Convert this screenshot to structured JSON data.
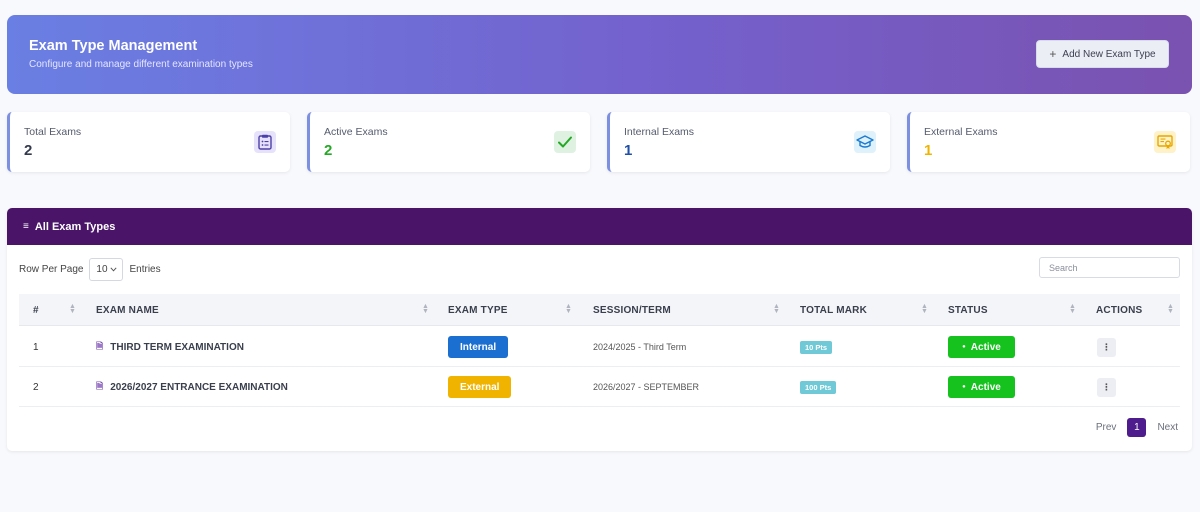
{
  "header": {
    "title": "Exam Type Management",
    "subtitle": "Configure and manage different examination types",
    "add_button_label": "Add New Exam Type"
  },
  "stats": [
    {
      "label": "Total Exams",
      "value": "2",
      "color": "#333a4d",
      "icon": "clipboard-icon",
      "icon_bg": "#e7e2fb",
      "icon_color": "#4b3fa8"
    },
    {
      "label": "Active Exams",
      "value": "2",
      "color": "#23a923",
      "icon": "check-icon",
      "icon_bg": "#dff2e2",
      "icon_color": "#23a923"
    },
    {
      "label": "Internal Exams",
      "value": "1",
      "color": "#1f4fa8",
      "icon": "graduation-cap-icon",
      "icon_bg": "#dff1fb",
      "icon_color": "#1a7bd1"
    },
    {
      "label": "External Exams",
      "value": "1",
      "color": "#f0b400",
      "icon": "certificate-icon",
      "icon_bg": "#fff2c8",
      "icon_color": "#e6a800"
    }
  ],
  "panel": {
    "title": "All Exam Types",
    "rows_per_page_label": "Row Per Page",
    "rows_per_page_value": "10",
    "entries_label": "Entries",
    "search_placeholder": "Search"
  },
  "table": {
    "columns": [
      "#",
      "EXAM NAME",
      "EXAM TYPE",
      "SESSION/TERM",
      "TOTAL MARK",
      "STATUS",
      "ACTIONS"
    ],
    "rows": [
      {
        "index": "1",
        "name": "THIRD TERM EXAMINATION",
        "type": "Internal",
        "session": "2024/2025 - Third Term",
        "mark": "10 Pts",
        "status": "Active"
      },
      {
        "index": "2",
        "name": "2026/2027 ENTRANCE EXAMINATION",
        "type": "External",
        "session": "2026/2027 - SEPTEMBER",
        "mark": "100 Pts",
        "status": "Active"
      }
    ]
  },
  "pagination": {
    "prev_label": "Prev",
    "current_page": "1",
    "next_label": "Next"
  },
  "colors": {
    "panel_header": "#4a1469",
    "internal_badge": "#1a6fd1",
    "external_badge": "#f0b400",
    "active_badge": "#16c21e",
    "mark_badge": "#6fc9d6",
    "pager_active": "#4e1c8c"
  }
}
